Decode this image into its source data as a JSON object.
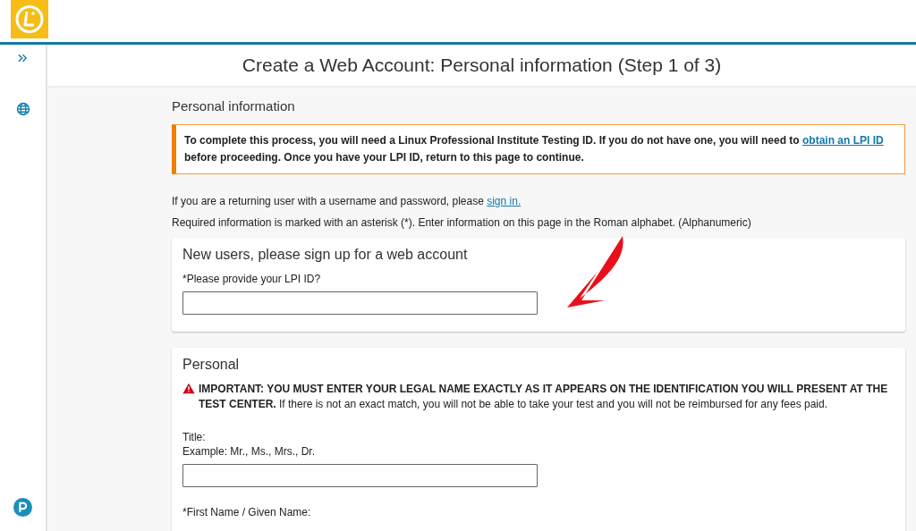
{
  "page_title": "Create a Web Account: Personal information (Step 1 of 3)",
  "section_title": "Personal information",
  "notice": {
    "text": "To complete this process, you will need a Linux Professional Institute Testing ID. If you do not have one, you will need to",
    "link": "obtain an LPI ID",
    "text_after": "before proceeding. Once you have your LPI ID, return to this page to continue."
  },
  "returning": {
    "text": "If you are a returning user with a username and password, please",
    "link": "sign in."
  },
  "required_note": "Required information is marked with an asterisk (*). Enter information on this page in the Roman alphabet. (Alphanumeric)",
  "signup_card": {
    "title": "New users, please sign up for a web account",
    "fields": [
      {
        "kind": "input",
        "label": "*Please provide your LPI ID?"
      }
    ]
  },
  "personal_card": {
    "title": "Personal",
    "warning": "**IMPORTANT: YOU MUST ENTER YOUR LEGAL NAME EXACTLY AS IT APPEARS ON THE IDENTIFICATION YOU WILL PRESENT AT THE TEST CENTER.** If there is not an exact match, you will not be able to take your test and you will not be reimbursed for any fees paid.",
    "fields": [
      {
        "kind": "input",
        "label": "Title:",
        "hint": "Example: Mr., Ms., Mrs., Dr."
      },
      {
        "kind": "label",
        "label": "*First Name / Given Name:"
      }
    ]
  }
}
